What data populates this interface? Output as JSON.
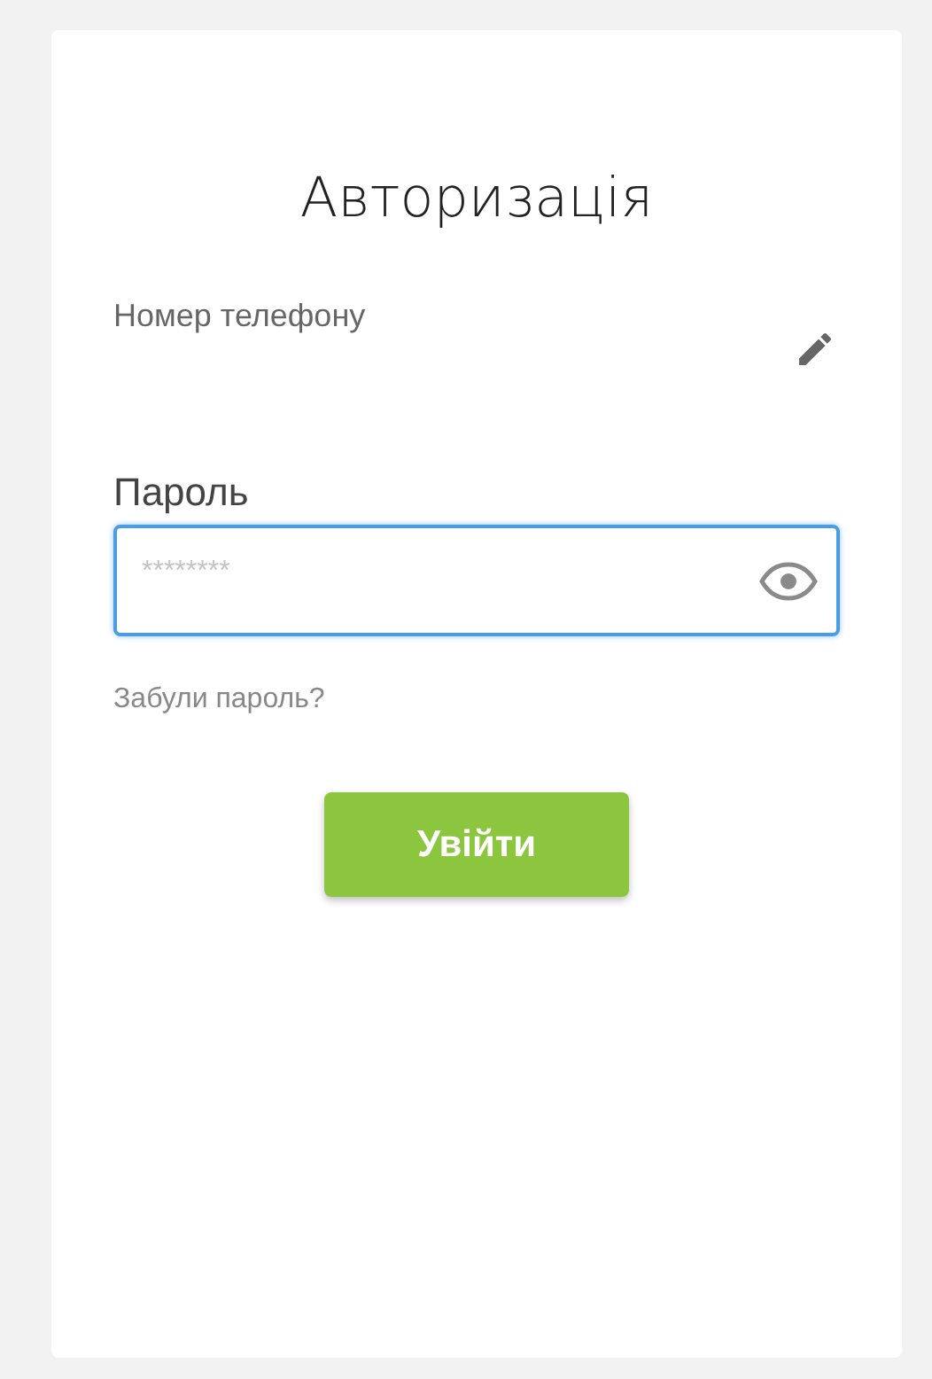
{
  "title": "Авторизація",
  "phone_field": {
    "label": "Номер телефону"
  },
  "password_field": {
    "label": "Пароль",
    "placeholder": "********",
    "focused": true
  },
  "forgot_link": "Забули пароль?",
  "login_button": "Увійти"
}
